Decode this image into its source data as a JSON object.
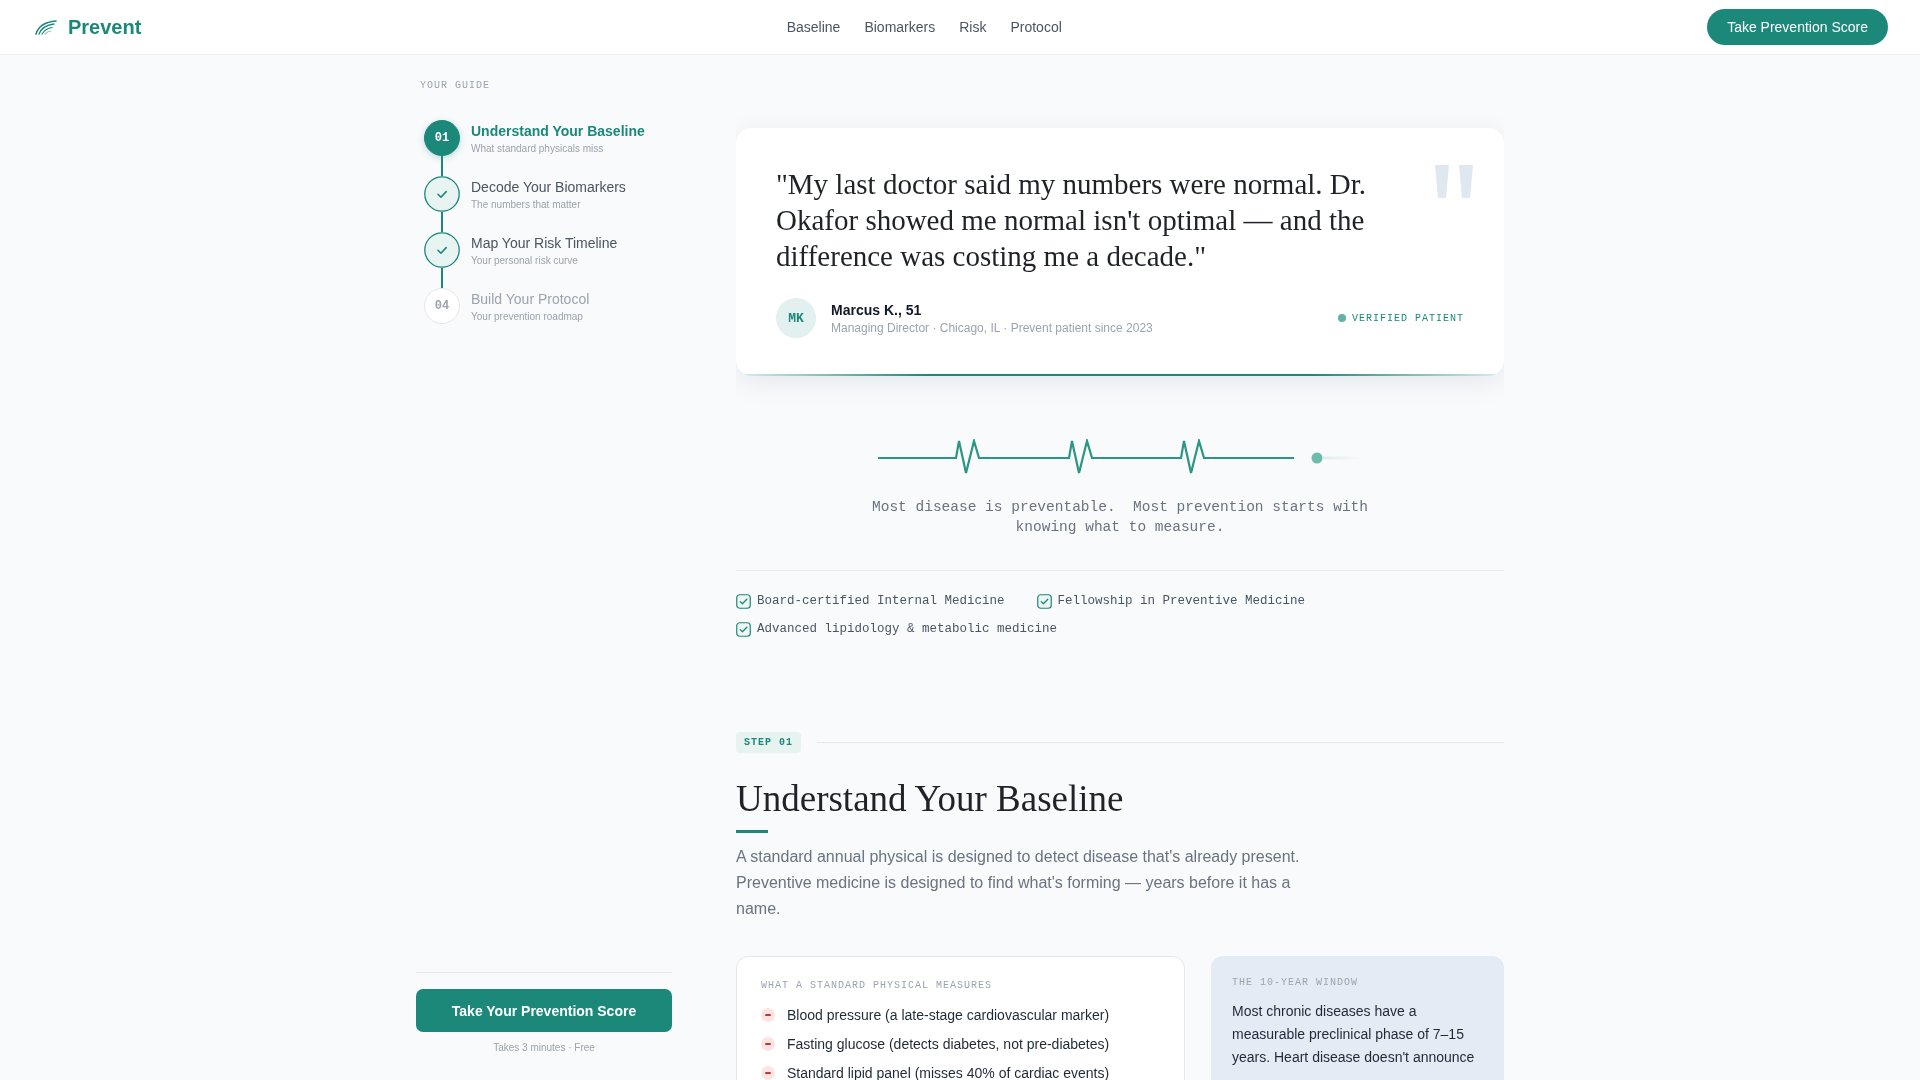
{
  "header": {
    "brand": "Prevent",
    "nav": [
      "Baseline",
      "Biomarkers",
      "Risk",
      "Protocol"
    ],
    "cta": "Take Prevention Score"
  },
  "sidebar": {
    "heading": "YOUR GUIDE",
    "steps": [
      {
        "number": "01",
        "title": "Understand Your Baseline",
        "subtitle": "What standard physicals miss",
        "selected": true,
        "completed": false
      },
      {
        "title": "Decode Your Biomarkers",
        "subtitle": "The numbers that matter",
        "selected": false,
        "completed": true
      },
      {
        "title": "Map Your Risk Timeline",
        "subtitle": "Your personal risk curve",
        "selected": false,
        "completed": true
      },
      {
        "number": "04",
        "title": "Build Your Protocol",
        "subtitle": "Your prevention roadmap",
        "selected": false,
        "completed": false
      }
    ],
    "cta": "Take Your Prevention Score",
    "cta_note": "Takes 3 minutes · Free"
  },
  "testimonial": {
    "quote": "\"My last doctor said my numbers were normal. Dr. Okafor showed me normal isn't optimal — and the difference was costing me a decade.\"",
    "initials": "MK",
    "name": "Marcus K., 51",
    "meta": "Managing Director · Chicago, IL · Prevent patient since 2023",
    "badge": "VERIFIED PATIENT"
  },
  "tagline": "Most disease is preventable.  Most prevention starts with knowing what to measure.",
  "credentials": [
    "Board-certified Internal Medicine",
    "Fellowship in Preventive Medicine",
    "Advanced lipidology & metabolic medicine"
  ],
  "step": {
    "badge": "STEP 01",
    "title": "Understand Your Baseline",
    "intro": "A standard annual physical is designed to detect disease that's already present. Preventive medicine is designed to find what's forming — years before it has a name.",
    "measures": {
      "label": "WHAT A STANDARD PHYSICAL MEASURES",
      "items": [
        "Blood pressure (a late-stage cardiovascular marker)",
        "Fasting glucose (detects diabetes, not pre-diabetes)",
        "Standard lipid panel (misses 40% of cardiac events)"
      ]
    },
    "window": {
      "label": "THE 10-YEAR WINDOW",
      "text": "Most chronic diseases have a measurable preclinical phase of 7–15 years. Heart disease doesn't announce"
    }
  }
}
